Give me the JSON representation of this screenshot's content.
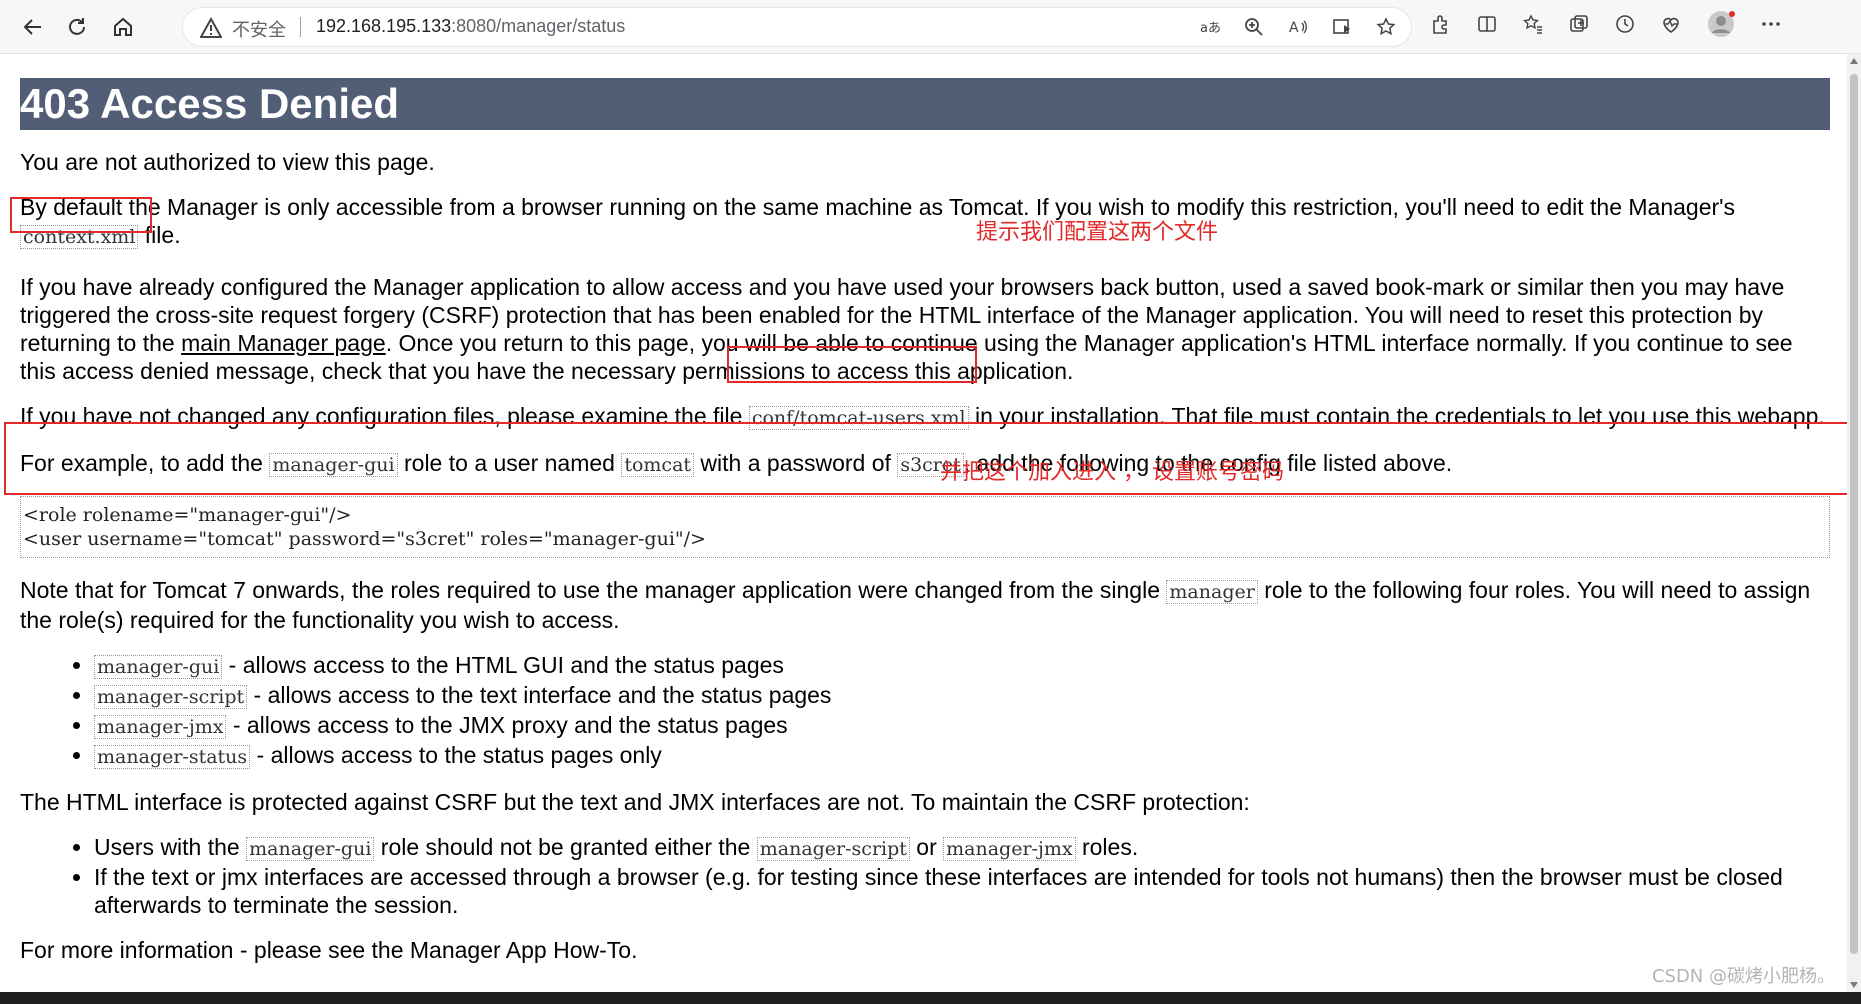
{
  "browser": {
    "security_label": "不安全",
    "url_host": "192.168.195.133",
    "url_path": ":8080/manager/status"
  },
  "page": {
    "title": "403 Access Denied",
    "p1": "You are not authorized to view this page.",
    "p2_before": "By default the Manager is only accessible from a browser running on the same machine as Tomcat. If you wish to modify this restriction, you'll need to edit the Manager's ",
    "p2_code": "context.xml",
    "p2_after": " file.",
    "p3_before": "If you have already configured the Manager application to allow access and you have used your browsers back button, used a saved book-mark or similar then you may have triggered the cross-site request forgery (CSRF) protection that has been enabled for the HTML interface of the Manager application. You will need to reset this protection by returning to the ",
    "p3_link": "main Manager page",
    "p3_after": ". Once you return to this page, you will be able to continue using the Manager application's HTML interface normally. If you continue to see this access denied message, check that you have the necessary permissions to access this application.",
    "p4_before": "If you have not changed any configuration files, please examine the file ",
    "p4_code": "conf/tomcat-users.xml",
    "p4_after": " in your installation. That file must contain the credentials to let you use this webapp.",
    "p5_a": "For example, to add the ",
    "p5_code1": "manager-gui",
    "p5_b": " role to a user named ",
    "p5_code2": "tomcat",
    "p5_c": " with a password of ",
    "p5_code3": "s3cret",
    "p5_d": ", add the following to the config file listed above.",
    "pre_line1": "<role rolename=\"manager-gui\"/>",
    "pre_line2": "<user username=\"tomcat\" password=\"s3cret\" roles=\"manager-gui\"/>",
    "p6_before": "Note that for Tomcat 7 onwards, the roles required to use the manager application were changed from the single ",
    "p6_code": "manager",
    "p6_after": " role to the following four roles. You will need to assign the role(s) required for the functionality you wish to access.",
    "roles": [
      {
        "code": "manager-gui",
        "desc": " - allows access to the HTML GUI and the status pages"
      },
      {
        "code": "manager-script",
        "desc": " - allows access to the text interface and the status pages"
      },
      {
        "code": "manager-jmx",
        "desc": " - allows access to the JMX proxy and the status pages"
      },
      {
        "code": "manager-status",
        "desc": " - allows access to the status pages only"
      }
    ],
    "p7": "The HTML interface is protected against CSRF but the text and JMX interfaces are not. To maintain the CSRF protection:",
    "csrf_item1_a": "Users with the ",
    "csrf_item1_code1": "manager-gui",
    "csrf_item1_b": " role should not be granted either the ",
    "csrf_item1_code2": "manager-script",
    "csrf_item1_c": " or ",
    "csrf_item1_code3": "manager-jmx",
    "csrf_item1_d": " roles.",
    "csrf_item2": "If the text or jmx interfaces are accessed through a browser (e.g. for testing since these interfaces are intended for tools not humans) then the browser must be closed afterwards to terminate the session.",
    "p8": "For more information - please see the Manager App How-To."
  },
  "annotations": {
    "note1": "提示我们配置这两个文件",
    "note2": "并把这个加入进入 ， 设置账号密码"
  },
  "watermark": "CSDN @碳烤小肥杨。",
  "colors": {
    "header_bg": "#525d76",
    "annotation": "#e12a2a"
  }
}
